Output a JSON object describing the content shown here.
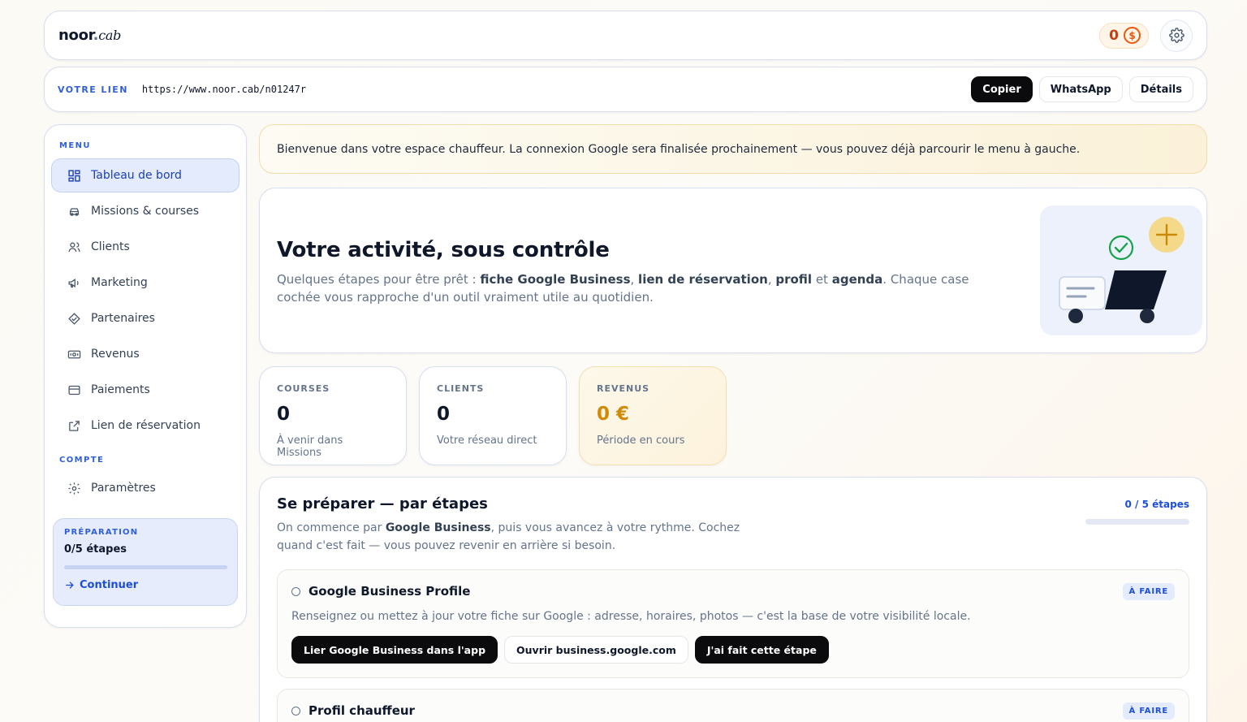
{
  "header": {
    "logo_main": "noor",
    "logo_dot": ".",
    "logo_cab": "cab",
    "coins": "0",
    "coin_icon": "dollar-coin-icon",
    "settings_icon": "gear-icon"
  },
  "link_bar": {
    "label": "VOTRE LIEN",
    "url": "https://www.noor.cab/n01247r",
    "buttons": {
      "copy": "Copier",
      "whatsapp": "WhatsApp",
      "details": "Détails"
    }
  },
  "sidebar": {
    "menu_label": "MENU",
    "items": [
      {
        "label": "Tableau de bord",
        "icon": "dashboard-icon",
        "active": true
      },
      {
        "label": "Missions & courses",
        "icon": "car-icon"
      },
      {
        "label": "Clients",
        "icon": "users-icon"
      },
      {
        "label": "Marketing",
        "icon": "megaphone-icon"
      },
      {
        "label": "Partenaires",
        "icon": "handshake-icon"
      },
      {
        "label": "Revenus",
        "icon": "banknote-icon"
      },
      {
        "label": "Paiements",
        "icon": "credit-card-icon"
      },
      {
        "label": "Lien de réservation",
        "icon": "external-link-icon"
      }
    ],
    "account_label": "COMPTE",
    "account_items": [
      {
        "label": "Paramètres",
        "icon": "gear-icon"
      }
    ],
    "prep": {
      "label": "PRÉPARATION",
      "count": "0/5 étapes",
      "progress": 0,
      "continue": "Continuer"
    }
  },
  "notice": {
    "text": "Bienvenue dans votre espace chauffeur. La connexion Google sera finalisée prochainement — vous pouvez déjà parcourir le menu à gauche."
  },
  "hero": {
    "title": "Votre activité, sous contrôle",
    "intro": "Quelques étapes pour être prêt : ",
    "b1": "fiche Google Business",
    "sep1": ", ",
    "b2": "lien de réservation",
    "sep2": ", ",
    "b3": "profil",
    "sep3": " et ",
    "b4": "agenda",
    "outro": ". Chaque case cochée vous rapproche d'un outil vraiment utile au quotidien."
  },
  "stats": [
    {
      "label": "COURSES",
      "value": "0",
      "sub": "À venir dans Missions"
    },
    {
      "label": "CLIENTS",
      "value": "0",
      "sub": "Votre réseau direct"
    },
    {
      "label": "REVENUS",
      "value": "0 €",
      "sub": "Période en cours"
    }
  ],
  "steps": {
    "title": "Se préparer — par étapes",
    "desc_pre": "On commence par ",
    "desc_bold": "Google Business",
    "desc_post": ", puis vous avancez à votre rythme. Cochez quand c'est fait — vous pouvez revenir en arrière si besoin.",
    "count": "0 / 5 étapes",
    "progress": 0,
    "items": [
      {
        "title": "Google Business Profile",
        "badge": "À FAIRE",
        "desc": "Renseignez ou mettez à jour votre fiche sur Google : adresse, horaires, photos — c'est la base de votre visibilité locale.",
        "actions": [
          "Lier Google Business dans l'app",
          "Ouvrir business.google.com",
          "J'ai fait cette étape"
        ]
      },
      {
        "title": "Profil chauffeur",
        "badge": "À FAIRE"
      }
    ]
  },
  "colors": {
    "accent": "#2f5fd8",
    "dark_button": "#0b0b0d",
    "gold": "#d18a06",
    "coin": "#ea580c"
  }
}
